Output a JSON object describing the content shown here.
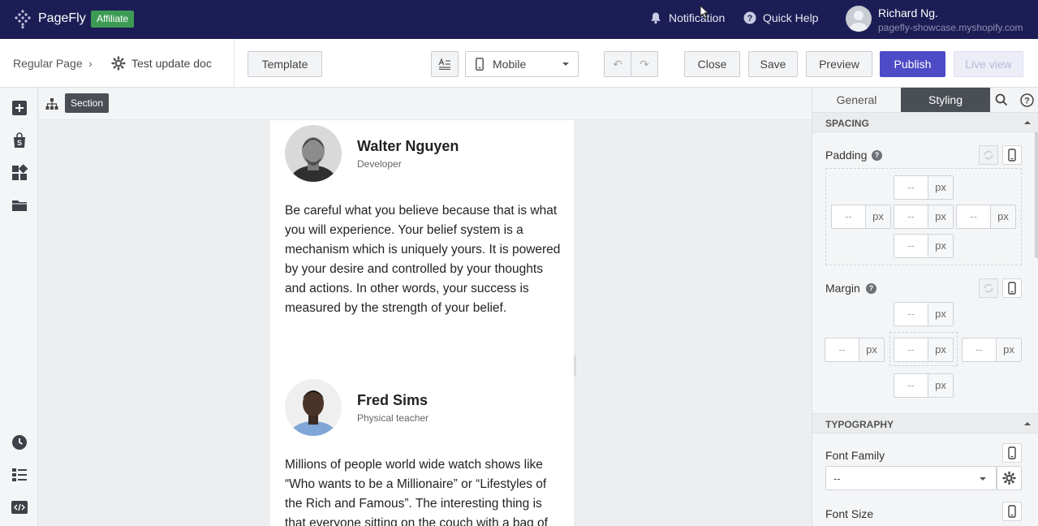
{
  "topbar": {
    "brand": "PageFly",
    "badge": "Affiliate",
    "notification": "Notification",
    "quick_help": "Quick Help",
    "user_name": "Richard Ng.",
    "user_shop": "pagefly-showcase.myshopify.com"
  },
  "toolbar": {
    "page_type": "Regular Page",
    "separator": "›",
    "page_name": "Test update doc",
    "template": "Template",
    "device": "Mobile",
    "undo": "↶",
    "redo": "↷",
    "close": "Close",
    "save": "Save",
    "preview": "Preview",
    "publish": "Publish",
    "live_view": "Live view"
  },
  "canvas": {
    "breadcrumb": "Section",
    "testimonials": [
      {
        "name": "Walter Nguyen",
        "role": "Developer",
        "quote": "Be careful what you believe because that is what you will experience. Your belief system is a mechanism which is uniquely yours. It is powered by your desire and controlled by your thoughts and actions. In other words, your success is measured by the strength of your belief."
      },
      {
        "name": "Fred Sims",
        "role": "Physical teacher",
        "quote": "Millions of people world wide watch shows like “Who wants to be a Millionaire” or “Lifestyles of the Rich and Famous”. The interesting thing is that everyone sitting on the couch with a bag of"
      }
    ]
  },
  "panel": {
    "tab_general": "General",
    "tab_styling": "Styling",
    "spacing_title": "SPACING",
    "padding_label": "Padding",
    "margin_label": "Margin",
    "empty_value": "--",
    "unit": "px",
    "typography_title": "TYPOGRAPHY",
    "font_family_label": "Font Family",
    "font_family_value": "--",
    "font_size_label": "Font Size",
    "help_glyph": "?"
  },
  "colors": {
    "topbar": "#1d1d56",
    "affiliate": "#3c9b54",
    "publish": "#4e4bc7",
    "active_tab": "#4a4e55"
  }
}
